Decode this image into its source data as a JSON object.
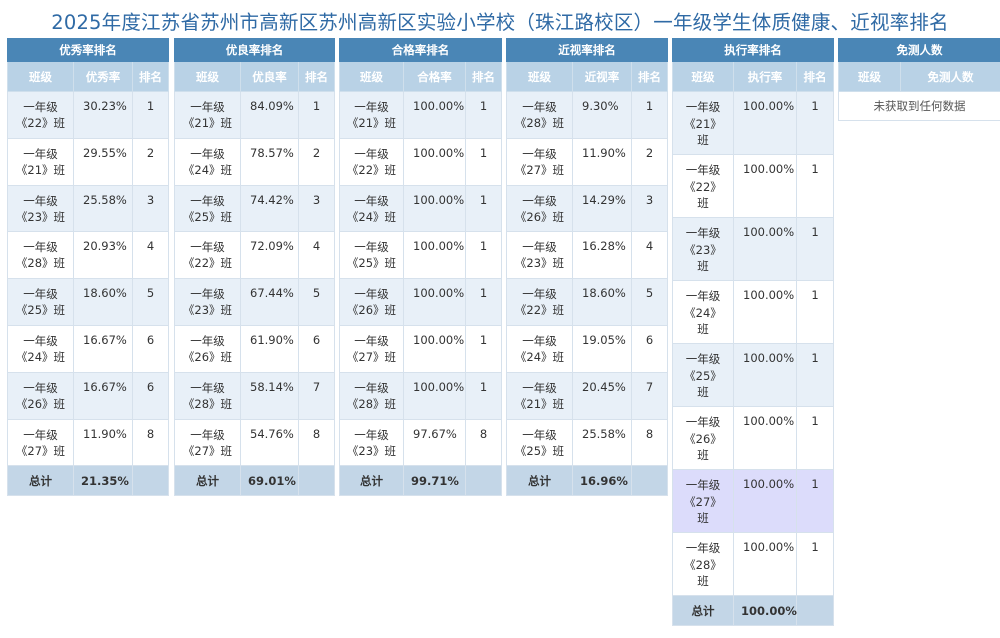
{
  "title": "2025年度江苏省苏州市高新区苏州高新区实验小学校（珠江路校区）一年级学生体质健康、近视率排名",
  "excellent": {
    "header": "优秀率排名",
    "columns": [
      "班级",
      "优秀率",
      "排名"
    ],
    "rows": [
      {
        "cls1": "一年级",
        "cls2": "《22》班",
        "value": "30.23%",
        "rank": "1"
      },
      {
        "cls1": "一年级",
        "cls2": "《21》班",
        "value": "29.55%",
        "rank": "2"
      },
      {
        "cls1": "一年级",
        "cls2": "《23》班",
        "value": "25.58%",
        "rank": "3"
      },
      {
        "cls1": "一年级",
        "cls2": "《28》班",
        "value": "20.93%",
        "rank": "4"
      },
      {
        "cls1": "一年级",
        "cls2": "《25》班",
        "value": "18.60%",
        "rank": "5"
      },
      {
        "cls1": "一年级",
        "cls2": "《24》班",
        "value": "16.67%",
        "rank": "6"
      },
      {
        "cls1": "一年级",
        "cls2": "《26》班",
        "value": "16.67%",
        "rank": "6"
      },
      {
        "cls1": "一年级",
        "cls2": "《27》班",
        "value": "11.90%",
        "rank": "8"
      }
    ],
    "total_label": "总计",
    "total_value": "21.35%"
  },
  "good": {
    "header": "优良率排名",
    "columns": [
      "班级",
      "优良率",
      "排名"
    ],
    "rows": [
      {
        "cls1": "一年级",
        "cls2": "《21》班",
        "value": "84.09%",
        "rank": "1"
      },
      {
        "cls1": "一年级",
        "cls2": "《24》班",
        "value": "78.57%",
        "rank": "2"
      },
      {
        "cls1": "一年级",
        "cls2": "《25》班",
        "value": "74.42%",
        "rank": "3"
      },
      {
        "cls1": "一年级",
        "cls2": "《22》班",
        "value": "72.09%",
        "rank": "4"
      },
      {
        "cls1": "一年级",
        "cls2": "《23》班",
        "value": "67.44%",
        "rank": "5"
      },
      {
        "cls1": "一年级",
        "cls2": "《26》班",
        "value": "61.90%",
        "rank": "6"
      },
      {
        "cls1": "一年级",
        "cls2": "《28》班",
        "value": "58.14%",
        "rank": "7"
      },
      {
        "cls1": "一年级",
        "cls2": "《27》班",
        "value": "54.76%",
        "rank": "8"
      }
    ],
    "total_label": "总计",
    "total_value": "69.01%"
  },
  "pass": {
    "header": "合格率排名",
    "columns": [
      "班级",
      "合格率",
      "排名"
    ],
    "rows": [
      {
        "cls1": "一年级",
        "cls2": "《21》班",
        "value": "100.00%",
        "rank": "1"
      },
      {
        "cls1": "一年级",
        "cls2": "《22》班",
        "value": "100.00%",
        "rank": "1"
      },
      {
        "cls1": "一年级",
        "cls2": "《24》班",
        "value": "100.00%",
        "rank": "1"
      },
      {
        "cls1": "一年级",
        "cls2": "《25》班",
        "value": "100.00%",
        "rank": "1"
      },
      {
        "cls1": "一年级",
        "cls2": "《26》班",
        "value": "100.00%",
        "rank": "1"
      },
      {
        "cls1": "一年级",
        "cls2": "《27》班",
        "value": "100.00%",
        "rank": "1"
      },
      {
        "cls1": "一年级",
        "cls2": "《28》班",
        "value": "100.00%",
        "rank": "1"
      },
      {
        "cls1": "一年级",
        "cls2": "《23》班",
        "value": "97.67%",
        "rank": "8"
      }
    ],
    "total_label": "总计",
    "total_value": "99.71%"
  },
  "myopia": {
    "header": "近视率排名",
    "columns": [
      "班级",
      "近视率",
      "排名"
    ],
    "rows": [
      {
        "cls1": "一年级",
        "cls2": "《28》班",
        "value": "9.30%",
        "rank": "1"
      },
      {
        "cls1": "一年级",
        "cls2": "《27》班",
        "value": "11.90%",
        "rank": "2"
      },
      {
        "cls1": "一年级",
        "cls2": "《26》班",
        "value": "14.29%",
        "rank": "3"
      },
      {
        "cls1": "一年级",
        "cls2": "《23》班",
        "value": "16.28%",
        "rank": "4"
      },
      {
        "cls1": "一年级",
        "cls2": "《22》班",
        "value": "18.60%",
        "rank": "5"
      },
      {
        "cls1": "一年级",
        "cls2": "《24》班",
        "value": "19.05%",
        "rank": "6"
      },
      {
        "cls1": "一年级",
        "cls2": "《21》班",
        "value": "20.45%",
        "rank": "7"
      },
      {
        "cls1": "一年级",
        "cls2": "《25》班",
        "value": "25.58%",
        "rank": "8"
      }
    ],
    "total_label": "总计",
    "total_value": "16.96%"
  },
  "execution": {
    "header": "执行率排名",
    "columns": [
      "班级",
      "执行率",
      "排名"
    ],
    "rows": [
      {
        "cls1": "一年级",
        "cls2": "《21》",
        "cls3": "班",
        "value": "100.00%",
        "rank": "1"
      },
      {
        "cls1": "一年级",
        "cls2": "《22》",
        "cls3": "班",
        "value": "100.00%",
        "rank": "1"
      },
      {
        "cls1": "一年级",
        "cls2": "《23》",
        "cls3": "班",
        "value": "100.00%",
        "rank": "1"
      },
      {
        "cls1": "一年级",
        "cls2": "《24》",
        "cls3": "班",
        "value": "100.00%",
        "rank": "1"
      },
      {
        "cls1": "一年级",
        "cls2": "《25》",
        "cls3": "班",
        "value": "100.00%",
        "rank": "1"
      },
      {
        "cls1": "一年级",
        "cls2": "《26》",
        "cls3": "班",
        "value": "100.00%",
        "rank": "1"
      },
      {
        "cls1": "一年级",
        "cls2": "《27》",
        "cls3": "班",
        "value": "100.00%",
        "rank": "1"
      },
      {
        "cls1": "一年级",
        "cls2": "《28》",
        "cls3": "班",
        "value": "100.00%",
        "rank": "1"
      }
    ],
    "total_label": "总计",
    "total_value": "100.00%"
  },
  "exempt": {
    "header": "免测人数",
    "columns": [
      "班级",
      "免测人数"
    ],
    "empty_text": "未获取到任何数据"
  }
}
